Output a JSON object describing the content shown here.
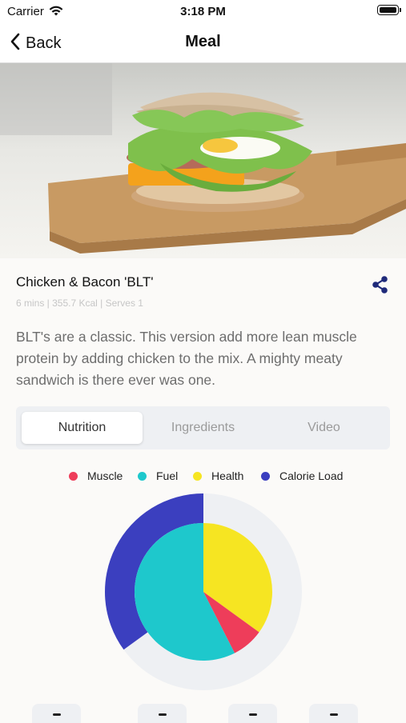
{
  "status_bar": {
    "carrier": "Carrier",
    "time": "3:18 PM"
  },
  "nav": {
    "back_label": "Back",
    "title": "Meal"
  },
  "meal": {
    "title": "Chicken & Bacon 'BLT'",
    "meta": "6 mins | 355.7 Kcal | Serves 1",
    "description": "BLT's are a classic. This version add more lean muscle protein by adding chicken to the mix. A mighty meaty sandwich is there ever was one."
  },
  "tabs": [
    {
      "label": "Nutrition",
      "active": true
    },
    {
      "label": "Ingredients",
      "active": false
    },
    {
      "label": "Video",
      "active": false
    }
  ],
  "colors": {
    "muscle": "#ee3d5a",
    "fuel": "#1ec8cc",
    "health": "#f6e522",
    "calorie_load": "#3b3fbf",
    "track": "#eef0f3"
  },
  "chart_data": {
    "type": "pie",
    "legend_position": "top",
    "legend": [
      "Muscle",
      "Fuel",
      "Health",
      "Calorie Load"
    ],
    "inner_pie": [
      {
        "name": "Health",
        "value": 35
      },
      {
        "name": "Muscle",
        "value": 7.5
      },
      {
        "name": "Fuel",
        "value": 57.5
      }
    ],
    "outer_ring": {
      "name": "Calorie Load",
      "value": 35,
      "max": 100
    }
  }
}
